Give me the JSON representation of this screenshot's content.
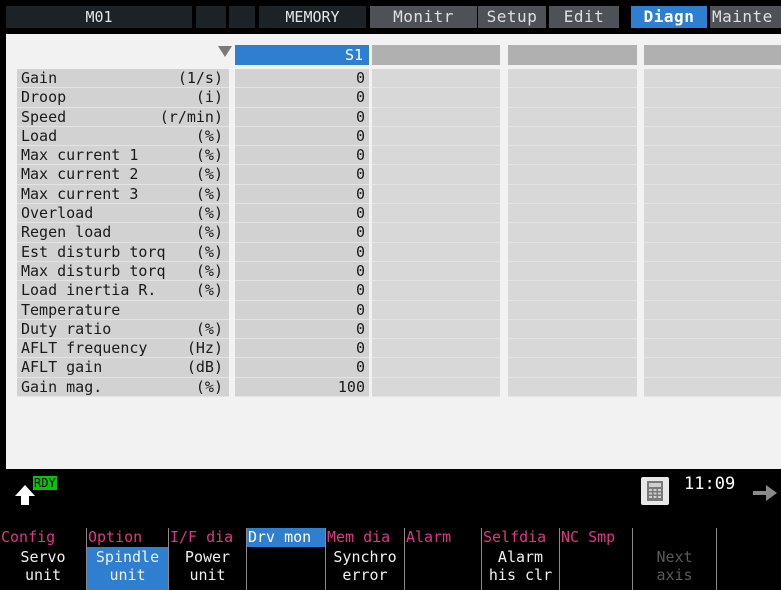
{
  "topbar": {
    "program": "M01",
    "mode": "MEMORY",
    "tabs": [
      "Monitr",
      "Setup",
      "Edit",
      "Diagn",
      "Mainte"
    ],
    "active_tab": "Diagn"
  },
  "table": {
    "axis_header": "S1",
    "rows": [
      {
        "name": "Gain",
        "unit": "(1/s)",
        "value": "0"
      },
      {
        "name": "Droop",
        "unit": "(i)",
        "value": "0"
      },
      {
        "name": "Speed",
        "unit": "(r/min)",
        "value": "0"
      },
      {
        "name": "Load",
        "unit": "(%)",
        "value": "0"
      },
      {
        "name": "Max current 1",
        "unit": "(%)",
        "value": "0"
      },
      {
        "name": "Max current 2",
        "unit": "(%)",
        "value": "0"
      },
      {
        "name": "Max current 3",
        "unit": "(%)",
        "value": "0"
      },
      {
        "name": "Overload",
        "unit": "(%)",
        "value": "0"
      },
      {
        "name": "Regen load",
        "unit": "(%)",
        "value": "0"
      },
      {
        "name": "Est disturb torq",
        "unit": "(%)",
        "value": "0"
      },
      {
        "name": "Max disturb torq",
        "unit": "(%)",
        "value": "0"
      },
      {
        "name": "Load inertia R.",
        "unit": "(%)",
        "value": "0"
      },
      {
        "name": "Temperature",
        "unit": "",
        "value": "0"
      },
      {
        "name": "Duty ratio",
        "unit": "(%)",
        "value": "0"
      },
      {
        "name": "AFLT frequency",
        "unit": "(Hz)",
        "value": "0"
      },
      {
        "name": "AFLT gain",
        "unit": "(dB)",
        "value": "0"
      },
      {
        "name": "Gain mag.",
        "unit": "(%)",
        "value": "100"
      }
    ]
  },
  "status": {
    "ready": "RDY",
    "time": "11:09",
    "up_icon": "up-arrow-icon",
    "calc_icon": "calculator-icon",
    "next_icon": "right-arrow-icon"
  },
  "menus": [
    {
      "top": "Config",
      "bottom": "Servo\nunit",
      "top_selected": false,
      "bottom_selected": false,
      "bottom_dim": false
    },
    {
      "top": "Option",
      "bottom": "Spindle\nunit",
      "top_selected": false,
      "bottom_selected": true,
      "bottom_dim": false
    },
    {
      "top": "I/F dia",
      "bottom": "Power\nunit",
      "top_selected": false,
      "bottom_selected": false,
      "bottom_dim": false
    },
    {
      "top": "Drv mon",
      "bottom": "",
      "top_selected": true,
      "bottom_selected": false,
      "bottom_dim": false
    },
    {
      "top": "Mem dia",
      "bottom": "Synchro\nerror",
      "top_selected": false,
      "bottom_selected": false,
      "bottom_dim": false
    },
    {
      "top": "Alarm",
      "bottom": "",
      "top_selected": false,
      "bottom_selected": false,
      "bottom_dim": false
    },
    {
      "top": "Selfdia",
      "bottom": "Alarm\nhis clr",
      "top_selected": false,
      "bottom_selected": false,
      "bottom_dim": false
    },
    {
      "top": "NC Smp",
      "bottom": "",
      "top_selected": false,
      "bottom_selected": false,
      "bottom_dim": false
    },
    {
      "top": "",
      "bottom": "Next\naxis",
      "top_selected": false,
      "bottom_selected": false,
      "bottom_dim": true
    },
    {
      "top": "",
      "bottom": "",
      "top_selected": false,
      "bottom_selected": false,
      "bottom_dim": false
    }
  ],
  "colors": {
    "accent": "#2f7fd0",
    "menu_top_text": "#e0358a",
    "ready": "#00c800",
    "panel_bg": "#f2f2f2",
    "cell_bg": "#d2d2d2"
  }
}
